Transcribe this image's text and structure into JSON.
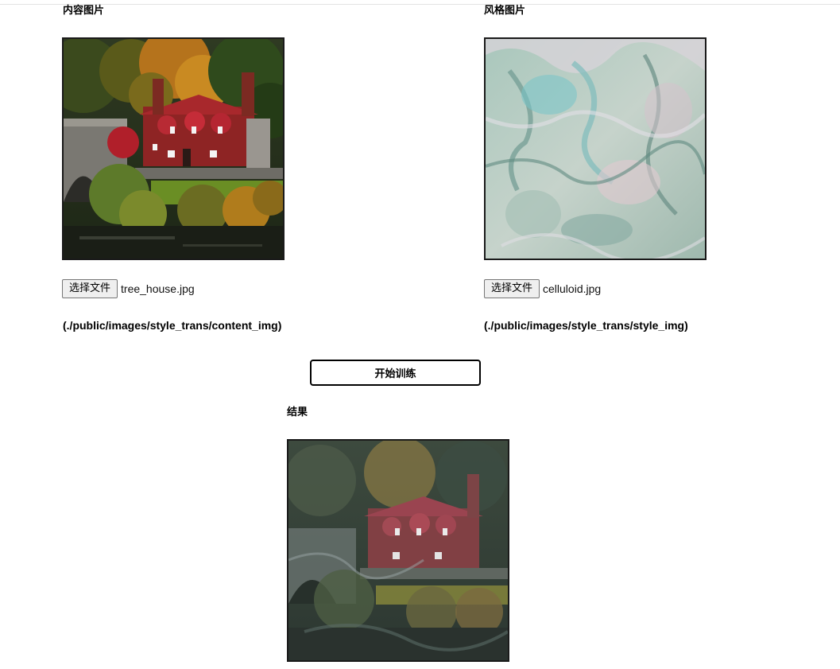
{
  "content": {
    "label": "内容图片",
    "file_button": "选择文件",
    "file_name": "tree_house.jpg",
    "path": "(./public/images/style_trans/content_img)"
  },
  "style": {
    "label": "风格图片",
    "file_button": "选择文件",
    "file_name": "celluloid.jpg",
    "path": "(./public/images/style_trans/style_img)"
  },
  "train_button": "开始训练",
  "result": {
    "label": "结果"
  }
}
